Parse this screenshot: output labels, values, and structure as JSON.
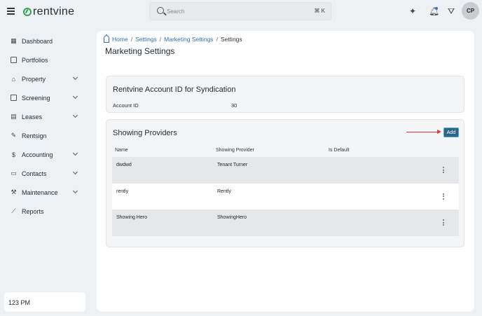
{
  "header": {
    "logo_text": "rentvine",
    "search_placeholder": "Search",
    "search_shortcut": "⌘ K",
    "avatar_initials": "CP"
  },
  "sidebar": {
    "items": [
      {
        "label": "Dashboard",
        "icon": "dashboard-icon",
        "expandable": false
      },
      {
        "label": "Portfolios",
        "icon": "portfolios-icon",
        "expandable": false
      },
      {
        "label": "Property",
        "icon": "property-icon",
        "expandable": true
      },
      {
        "label": "Screening",
        "icon": "screening-icon",
        "expandable": true
      },
      {
        "label": "Leases",
        "icon": "leases-icon",
        "expandable": true
      },
      {
        "label": "Rentsign",
        "icon": "rentsign-icon",
        "expandable": false
      },
      {
        "label": "Accounting",
        "icon": "dollar-icon",
        "expandable": true
      },
      {
        "label": "Contacts",
        "icon": "contacts-icon",
        "expandable": true
      },
      {
        "label": "Maintenance",
        "icon": "wrench-icon",
        "expandable": true
      },
      {
        "label": "Reports",
        "icon": "chart-icon",
        "expandable": false
      }
    ],
    "clock": "123 PM"
  },
  "breadcrumb": {
    "home": "Home",
    "settings": "Settings",
    "marketing": "Marketing Settings",
    "current": "Settings"
  },
  "page_title": "Marketing Settings",
  "syndication": {
    "title": "Rentvine Account ID for Syndication",
    "account_label": "Account ID",
    "account_value": "30"
  },
  "providers": {
    "title": "Showing Providers",
    "add_label": "Add",
    "columns": {
      "name": "Name",
      "provider": "Showing Provider",
      "default": "Is Default"
    },
    "rows": [
      {
        "name": "dwdwd",
        "provider": "Tenant Turner",
        "default": ""
      },
      {
        "name": "rently",
        "provider": "Rently",
        "default": ""
      },
      {
        "name": "Showing Hero",
        "provider": "ShowingHero",
        "default": ""
      }
    ]
  },
  "colors": {
    "accent_button": "#2e6585",
    "link": "#2a6fb4",
    "annotation_arrow": "#e03a2f",
    "notification_dot": "#2f6fdb"
  }
}
